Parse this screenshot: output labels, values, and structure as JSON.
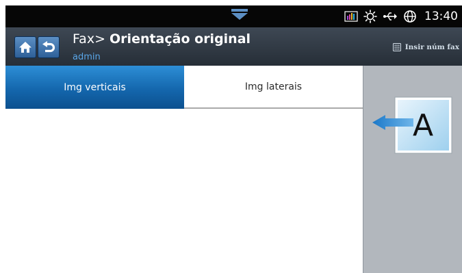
{
  "status_bar": {
    "icons": [
      "signal-bars-icon",
      "sun-icon",
      "usb-icon",
      "globe-icon"
    ],
    "time": "13:40",
    "handle_icon": "pull-down-handle-icon"
  },
  "header": {
    "nav_icons": [
      "home-icon",
      "back-icon"
    ],
    "title_prefix": "Fax> ",
    "title_main": "Orientação original",
    "user": "admin",
    "fax_number_button": "Insir núm fax"
  },
  "tabs": [
    {
      "label": "Img verticais",
      "selected": true
    },
    {
      "label": "Img laterais",
      "selected": false
    }
  ],
  "preview": {
    "letter": "A",
    "arrow": "left-arrow-icon"
  },
  "colors": {
    "status_bar": "#060606",
    "header": "#2f3841",
    "selected_tab": "#1870b8",
    "side_panel": "#b2b7bd",
    "user_text": "#5aa6e8"
  }
}
